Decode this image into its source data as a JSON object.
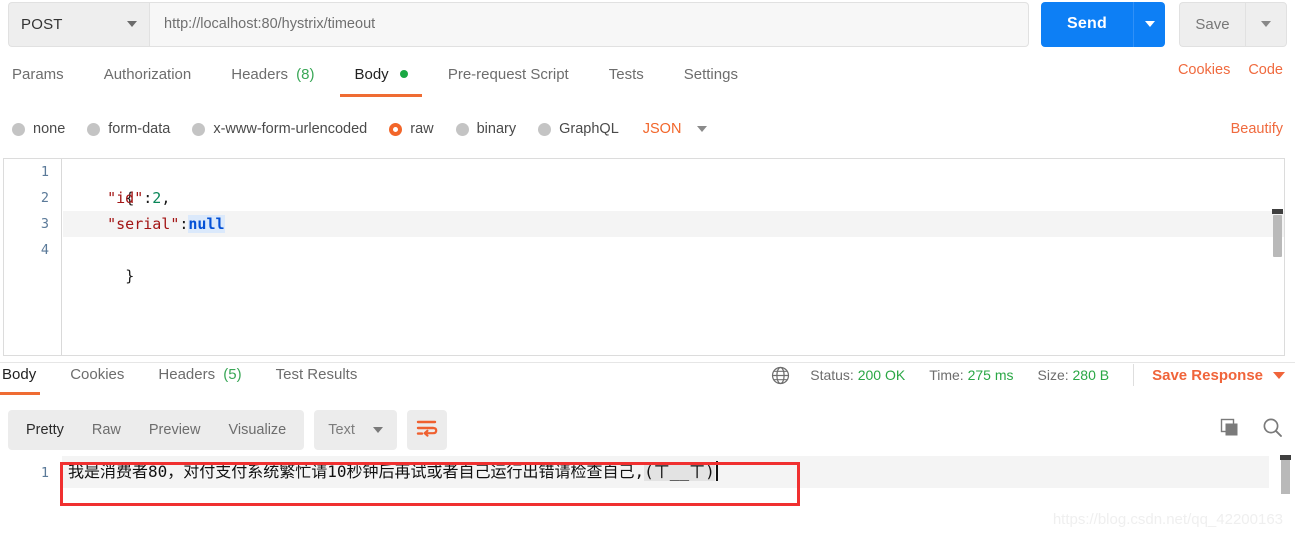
{
  "request": {
    "method": "POST",
    "url": "http://localhost:80/hystrix/timeout",
    "send_label": "Send",
    "save_label": "Save",
    "tabs": [
      {
        "label": "Params",
        "count": null,
        "active": false,
        "dot": false
      },
      {
        "label": "Authorization",
        "count": null,
        "active": false,
        "dot": false
      },
      {
        "label": "Headers",
        "count": "(8)",
        "active": false,
        "dot": false
      },
      {
        "label": "Body",
        "count": null,
        "active": true,
        "dot": true
      },
      {
        "label": "Pre-request Script",
        "count": null,
        "active": false,
        "dot": false
      },
      {
        "label": "Tests",
        "count": null,
        "active": false,
        "dot": false
      },
      {
        "label": "Settings",
        "count": null,
        "active": false,
        "dot": false
      }
    ],
    "links": {
      "cookies": "Cookies",
      "code": "Code"
    },
    "body_types": [
      {
        "label": "none",
        "checked": false
      },
      {
        "label": "form-data",
        "checked": false
      },
      {
        "label": "x-www-form-urlencoded",
        "checked": false
      },
      {
        "label": "raw",
        "checked": true
      },
      {
        "label": "binary",
        "checked": false
      },
      {
        "label": "GraphQL",
        "checked": false
      }
    ],
    "raw_format": "JSON",
    "beautify_label": "Beautify",
    "editor": {
      "line_numbers": [
        "1",
        "2",
        "3",
        "4"
      ],
      "lines": [
        {
          "indent": "",
          "parts": [
            {
              "t": "{",
              "c": "punct"
            }
          ]
        },
        {
          "indent": "    ",
          "parts": [
            {
              "t": "\"id\"",
              "c": "str"
            },
            {
              "t": ":",
              "c": "punct"
            },
            {
              "t": "2",
              "c": "num"
            },
            {
              "t": ",",
              "c": "punct"
            }
          ]
        },
        {
          "indent": "    ",
          "parts": [
            {
              "t": "\"serial\"",
              "c": "str"
            },
            {
              "t": ":",
              "c": "punct"
            },
            {
              "t": "null",
              "c": "null"
            }
          ]
        },
        {
          "indent": "",
          "parts": [
            {
              "t": "}",
              "c": "punct"
            }
          ]
        }
      ],
      "raw_text": "{\n    \"id\":2,\n    \"serial\":null\n}"
    }
  },
  "response": {
    "tabs": [
      {
        "label": "Body",
        "count": null,
        "active": true
      },
      {
        "label": "Cookies",
        "count": null,
        "active": false
      },
      {
        "label": "Headers",
        "count": "(5)",
        "active": false
      },
      {
        "label": "Test Results",
        "count": null,
        "active": false
      }
    ],
    "meta": {
      "status_label": "Status:",
      "status_value": "200 OK",
      "time_label": "Time:",
      "time_value": "275 ms",
      "size_label": "Size:",
      "size_value": "280 B"
    },
    "save_response_label": "Save Response",
    "view_modes": [
      {
        "label": "Pretty",
        "active": true
      },
      {
        "label": "Raw",
        "active": false
      },
      {
        "label": "Preview",
        "active": false
      },
      {
        "label": "Visualize",
        "active": false
      }
    ],
    "format": "Text",
    "body": {
      "line_number": "1",
      "text": "我是消费者80，对付支付系统繁忙请10秒钟后再试或者自己运行出错请检查自己,",
      "emoticon": "(ㄒ__ㄒ)"
    }
  },
  "colors": {
    "accent_orange": "#f0643a",
    "send_blue": "#0d7ff5",
    "status_green": "#2aa745",
    "highlight_red": "#f03030"
  },
  "watermark": "https://blog.csdn.net/qq_42200163"
}
